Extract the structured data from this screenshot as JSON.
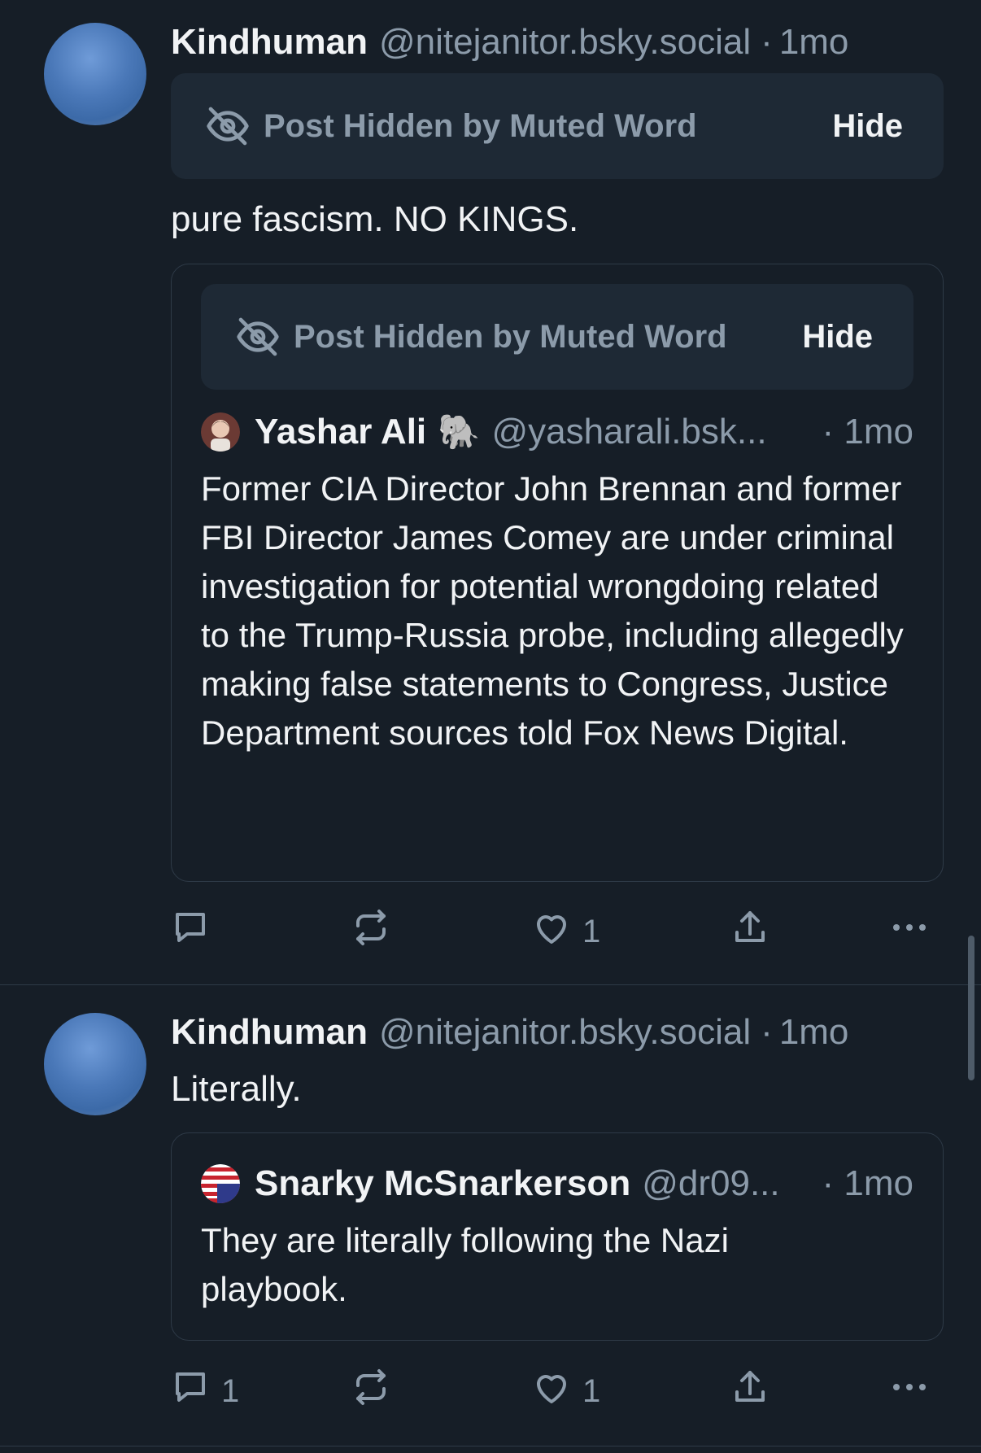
{
  "posts": [
    {
      "author": "Kindhuman",
      "handle": "@nitejanitor.bsky.social",
      "dot": "·",
      "time": "1mo",
      "muted": {
        "text": "Post Hidden by Muted Word",
        "hide_label": "Hide"
      },
      "text": "pure fascism. NO KINGS.",
      "quote": {
        "muted": {
          "text": "Post Hidden by Muted Word",
          "hide_label": "Hide"
        },
        "author": "Yashar Ali",
        "emoji": "🐘",
        "handle": "@yasharali.bsk...",
        "time": "· 1mo",
        "text": "Former CIA Director John Brennan and former FBI Director James Comey are under criminal investigation for potential wrongdoing related to the Trump-Russia probe, including allegedly making false statements to Congress, Justice Department sources told Fox News Digital."
      },
      "actions": {
        "reply_count": "",
        "repost_count": "",
        "like_count": "1"
      }
    },
    {
      "author": "Kindhuman",
      "handle": "@nitejanitor.bsky.social",
      "dot": "·",
      "time": "1mo",
      "text": "Literally.",
      "quote": {
        "author": "Snarky McSnarkerson",
        "handle": "@dr09...",
        "time": "· 1mo",
        "text": "They are literally following the Nazi playbook."
      },
      "actions": {
        "reply_count": "1",
        "repost_count": "",
        "like_count": "1"
      }
    }
  ],
  "icons": [
    "eye-slash-icon",
    "reply-icon",
    "repost-icon",
    "like-icon",
    "share-icon",
    "more-icon"
  ],
  "colors": {
    "background": "#161e27",
    "muted_box": "#1e2935",
    "border": "#2e3a47",
    "secondary_text": "#8c9baa",
    "primary_text": "#f1f3f5"
  }
}
